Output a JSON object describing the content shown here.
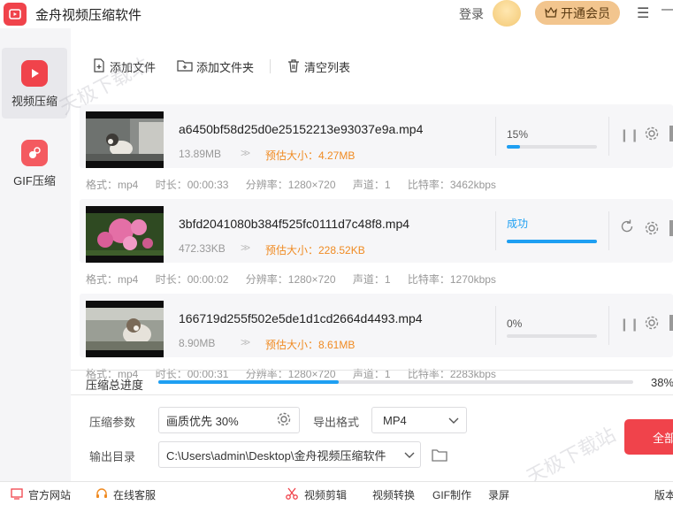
{
  "app": {
    "title": "金舟视频压缩软件",
    "login_label": "登录",
    "vip_label": "开通会员"
  },
  "sidebar": {
    "items": [
      {
        "label": "视频压缩"
      },
      {
        "label": "GIF压缩"
      }
    ]
  },
  "toolbar": {
    "add_file": "添加文件",
    "add_folder": "添加文件夹",
    "clear_list": "清空列表"
  },
  "files": [
    {
      "name": "a6450bf58d25d0e25152213e93037e9a.mp4",
      "size": "13.89MB",
      "estimate": "预估大小：4.27MB",
      "status": "15%",
      "progress": 0.15,
      "meta": {
        "format": "格式：mp4",
        "duration": "时长：00:00:33",
        "resolution": "分辨率：1280×720",
        "channels": "声道：1",
        "bitrate": "比特率：3462kbps"
      }
    },
    {
      "name": "3bfd2041080b384f525fc0111d7c48f8.mp4",
      "size": "472.33KB",
      "estimate": "预估大小：228.52KB",
      "status": "成功",
      "progress": 1.0,
      "meta": {
        "format": "格式：mp4",
        "duration": "时长：00:00:02",
        "resolution": "分辨率：1280×720",
        "channels": "声道：1",
        "bitrate": "比特率：1270kbps"
      }
    },
    {
      "name": "166719d255f502e5de1d1cd2664d4493.mp4",
      "size": "8.90MB",
      "estimate": "预估大小：8.61MB",
      "status": "0%",
      "progress": 0.0,
      "meta": {
        "format": "格式：mp4",
        "duration": "时长：00:00:31",
        "resolution": "分辨率：1280×720",
        "channels": "声道：1",
        "bitrate": "比特率：2283kbps"
      }
    }
  ],
  "total": {
    "label": "压缩总进度",
    "percent": "38%",
    "progress": 0.38
  },
  "settings": {
    "param_label": "压缩参数",
    "param_value": "画质优先 30%",
    "format_label": "导出格式",
    "format_value": "MP4",
    "output_label": "输出目录",
    "output_value": "C:\\Users\\admin\\Desktop\\金舟视频压缩软件",
    "start_label": "全部"
  },
  "watermark": "天极下载站",
  "footer": {
    "website": "官方网站",
    "support": "在线客服",
    "video_edit": "视频剪辑",
    "video_convert": "视频转换",
    "gif_make": "GIF制作",
    "record": "录屏",
    "version": "版本"
  },
  "colors": {
    "accent": "#f0434b",
    "progress": "#1e9ff2",
    "success": "#1e9ff2",
    "estimate": "#f08b22",
    "vip": "#f2c58e"
  }
}
